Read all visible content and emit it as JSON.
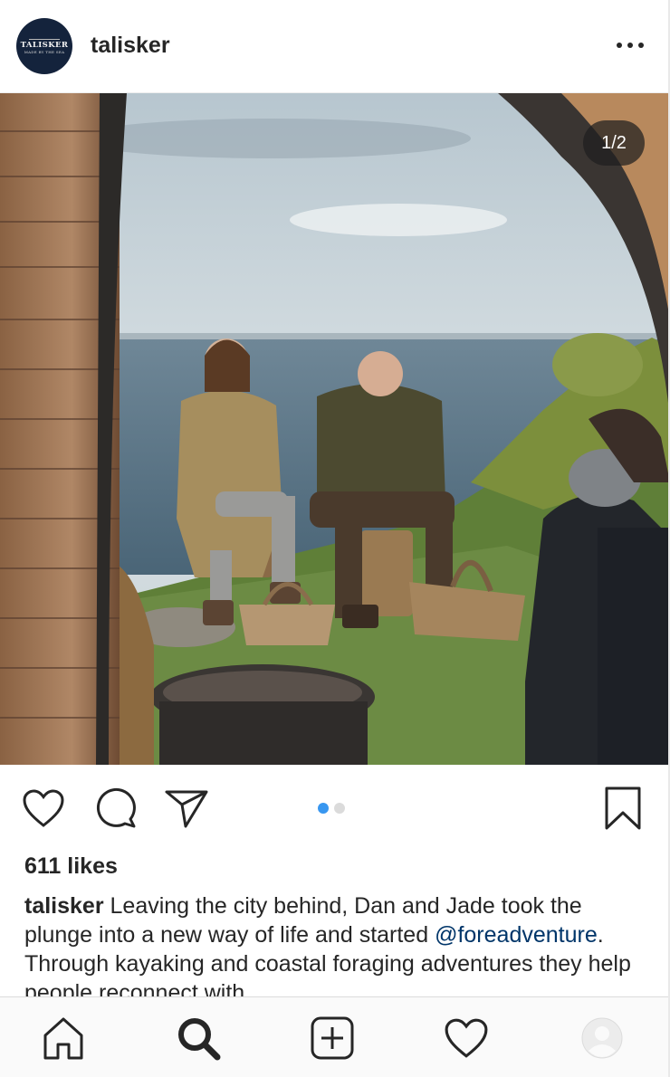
{
  "header": {
    "avatar_logo_text": "TALISKER",
    "avatar_logo_subtext": "MADE BY THE SEA",
    "username": "talisker",
    "more_icon": "more-horizontal-icon"
  },
  "post": {
    "image_counter": "1/2",
    "carousel": {
      "total": 2,
      "active_index": 0
    },
    "likes_text": "611 likes",
    "caption": {
      "user": "talisker",
      "text_before_mention": " Leaving the city behind, Dan and Jade took the plunge into a new way of life and started ",
      "mention": "@foreadventure",
      "text_after_mention": ". Through kayaking and coastal foraging adventures they help people reconnect with"
    }
  },
  "actions": {
    "like_icon": "heart-icon",
    "comment_icon": "comment-icon",
    "share_icon": "paper-plane-icon",
    "save_icon": "bookmark-icon"
  },
  "bottom_nav": {
    "items": [
      "home-icon",
      "search-icon",
      "add-post-icon",
      "activity-heart-icon",
      "profile-avatar-icon"
    ]
  },
  "colors": {
    "accent_blue": "#3897f0",
    "mention_blue": "#003569",
    "text": "#262626",
    "avatar_bg": "#14233c"
  }
}
